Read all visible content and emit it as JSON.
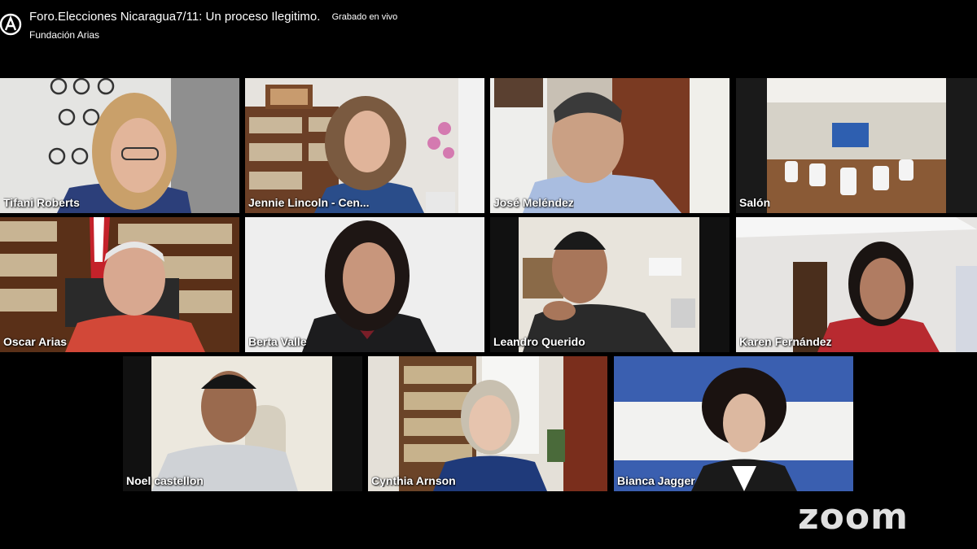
{
  "header": {
    "title": "Foro.Elecciones Nicaragua7/11: Un proceso Ilegitimo.",
    "live_badge": "Grabado en vivo",
    "org": "Fundación Arias",
    "logo_icon": "fundacion-arias-logo-icon"
  },
  "participants": [
    {
      "name": "Tifani Roberts"
    },
    {
      "name": "Jennie Lincoln - Cen..."
    },
    {
      "name": "José Meléndez"
    },
    {
      "name": "Salón"
    },
    {
      "name": "Oscar Arias"
    },
    {
      "name": "Berta Valle"
    },
    {
      "name": "Leandro Querido"
    },
    {
      "name": "Karen Fernández"
    },
    {
      "name": "Noel castellon"
    },
    {
      "name": "Cynthia Arnson"
    },
    {
      "name": "Bianca Jagger"
    }
  ],
  "brand": {
    "zoom_wordmark": "zoom"
  },
  "colors": {
    "background": "#000000",
    "nicaragua_blue": "#3a5fb0"
  }
}
